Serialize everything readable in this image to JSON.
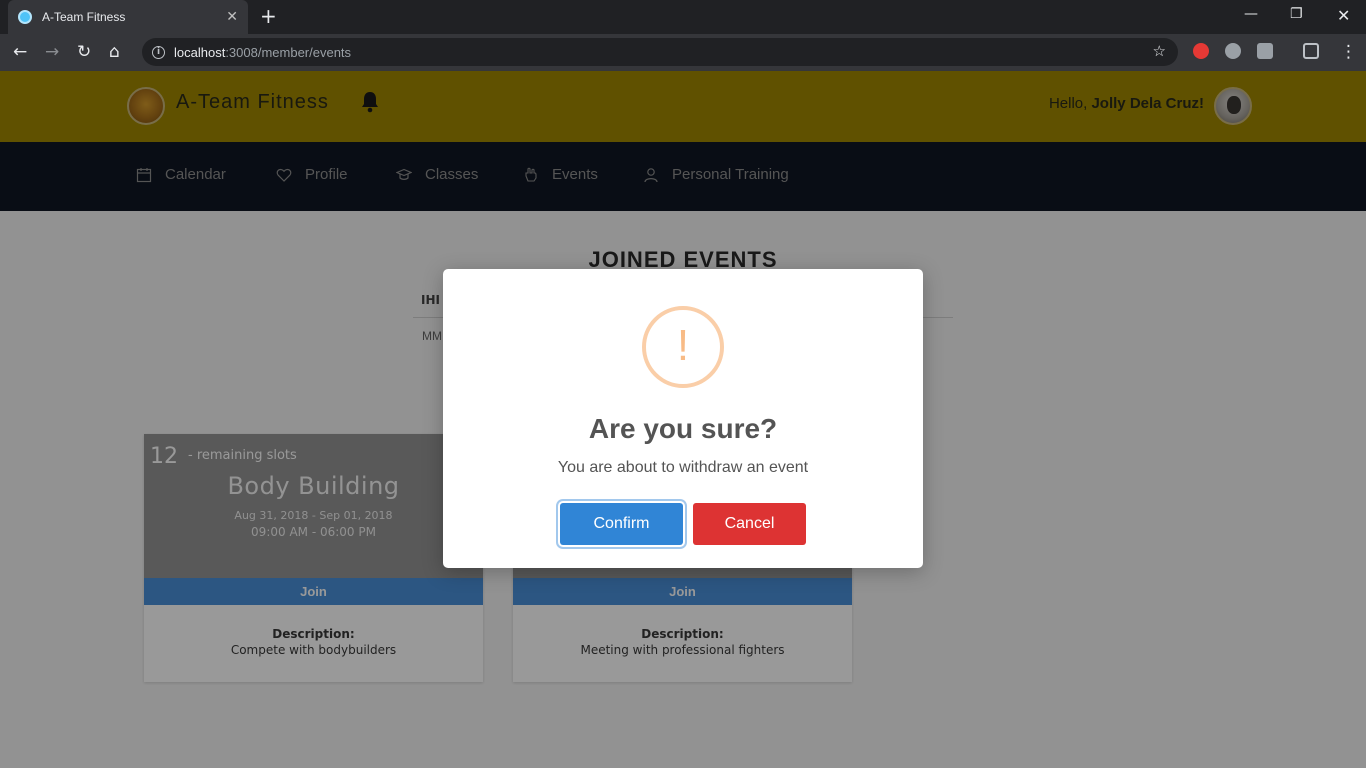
{
  "browser": {
    "tab_title": "A-Team Fitness",
    "url_host": "localhost",
    "url_path": ":3008/member/events"
  },
  "header": {
    "brand": "A-Team Fitness",
    "greeting_prefix": "Hello, ",
    "user_name": "Jolly Dela Cruz!"
  },
  "nav": {
    "items": [
      {
        "label": "Calendar",
        "icon": "calendar-icon"
      },
      {
        "label": "Profile",
        "icon": "heart-icon"
      },
      {
        "label": "Classes",
        "icon": "graduation-cap-icon"
      },
      {
        "label": "Events",
        "icon": "hand-icon"
      },
      {
        "label": "Personal Training",
        "icon": "user-icon"
      }
    ]
  },
  "main": {
    "section_title": "JOINED EVENTS",
    "table_head_icon": "IHI",
    "table_first_cell": "MM",
    "cards": [
      {
        "slots_count": "12",
        "slots_text": "- remaining slots",
        "title": "Body Building",
        "date_range": "Aug 31, 2018 - Sep 01, 2018",
        "time_range": "09:00 AM - 06:00 PM",
        "join_label": "Join",
        "description_label": "Description:",
        "description": "Compete with bodybuilders"
      },
      {
        "slots_count": "",
        "slots_text": "",
        "title": "",
        "date_range": "",
        "time_range": "",
        "join_label": "Join",
        "description_label": "Description:",
        "description": "Meeting with professional fighters"
      }
    ]
  },
  "modal": {
    "icon_glyph": "!",
    "title": "Are you sure?",
    "text": "You are about to withdraw an event",
    "confirm_label": "Confirm",
    "cancel_label": "Cancel"
  },
  "colors": {
    "header_bg": "#a08800",
    "nav_bg": "#0f1623",
    "confirm": "#3085d6",
    "cancel": "#dd3333",
    "warning": "#f8bb86"
  }
}
